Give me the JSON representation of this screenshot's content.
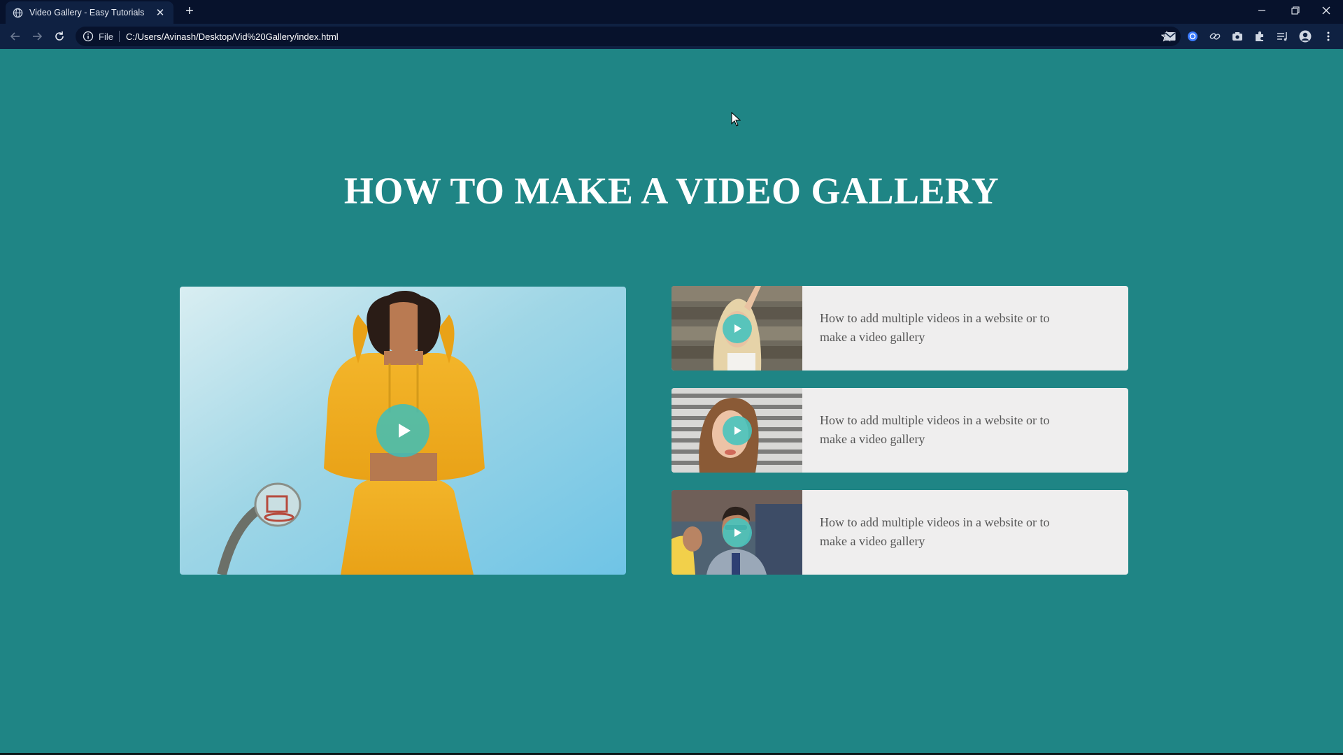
{
  "browser": {
    "tab_title": "Video Gallery - Easy Tutorials",
    "url_scheme": "File",
    "url": "C:/Users/Avinash/Desktop/Vid%20Gallery/index.html"
  },
  "page": {
    "title": "HOW TO MAKE A VIDEO GALLERY",
    "main_video": {
      "description": "woman in yellow hoodie near basketball hoop"
    },
    "playlist": [
      {
        "text": "How to add multiple videos in a website or to make a video gallery"
      },
      {
        "text": "How to add multiple videos in a website or to make a video gallery"
      },
      {
        "text": "How to add multiple videos in a website or to make a video gallery"
      }
    ]
  },
  "colors": {
    "page_background": "#1f8585",
    "card_background": "#efeeee",
    "play_button": "#3ebeb8",
    "title_text": "#ffffff"
  }
}
